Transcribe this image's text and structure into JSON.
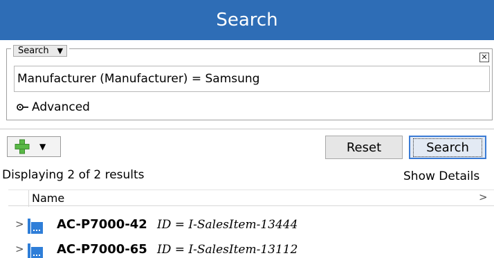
{
  "header": {
    "title": "Search"
  },
  "search_panel": {
    "mode_label": "Search",
    "close_label": "✕",
    "criteria_value": "Manufacturer (Manufacturer) = Samsung",
    "advanced_label": "Advanced"
  },
  "toolbar": {
    "add_label": "+",
    "reset_label": "Reset",
    "search_label": "Search"
  },
  "results": {
    "count_text": "Displaying 2 of 2 results",
    "show_details_label": "Show Details",
    "columns": [
      "Name"
    ],
    "rows": [
      {
        "name": "AC-P7000-42",
        "id_text": "ID = I-SalesItem-13444"
      },
      {
        "name": "AC-P7000-65",
        "id_text": "ID = I-SalesItem-13112"
      }
    ]
  },
  "colors": {
    "title_bar": "#2e6db6",
    "add_icon": "#59b846",
    "item_icon": "#2f7ed8"
  },
  "icons": {
    "advanced": "key-icon",
    "add": "plus-icon",
    "expander": "chevron-right-icon",
    "item": "sales-item-icon"
  }
}
